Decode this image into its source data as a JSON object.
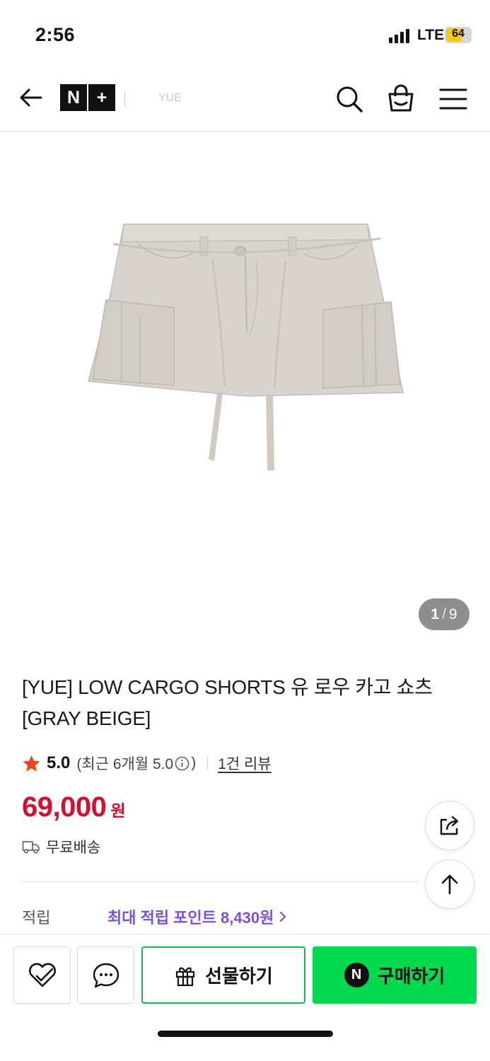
{
  "status_bar": {
    "time": "2:56",
    "network": "LTE",
    "battery": "64"
  },
  "nav": {
    "logo_left": "N",
    "logo_right": "+",
    "store_name": "YUE",
    "icons": [
      "back-arrow-icon",
      "search-icon",
      "shopping-bag-icon",
      "menu-icon"
    ]
  },
  "gallery": {
    "current": "1",
    "separator": "/",
    "total": "9"
  },
  "product": {
    "title": "[YUE] LOW CARGO SHORTS 유 로우 카고 쇼츠 [GRAY BEIGE]",
    "rating": "5.0",
    "rating_recent_prefix": "(최근 6개월 5.0",
    "rating_recent_suffix": ")",
    "review_link": "1건 리뷰",
    "price": "69,000",
    "price_unit": "원",
    "delivery": "무료배송",
    "points_label": "적립",
    "points_value": "최대 적립 포인트 8,430원"
  },
  "actions": {
    "gift_label": "선물하기",
    "buy_label": "구매하기",
    "npay_letter": "N"
  },
  "colors": {
    "price": "#d4102f",
    "points": "#7b4fe0",
    "buy_button": "#03d94f",
    "gift_border": "#16b94a",
    "rating_star": "#f0461e",
    "product_fabric": "#d8d3cd"
  }
}
